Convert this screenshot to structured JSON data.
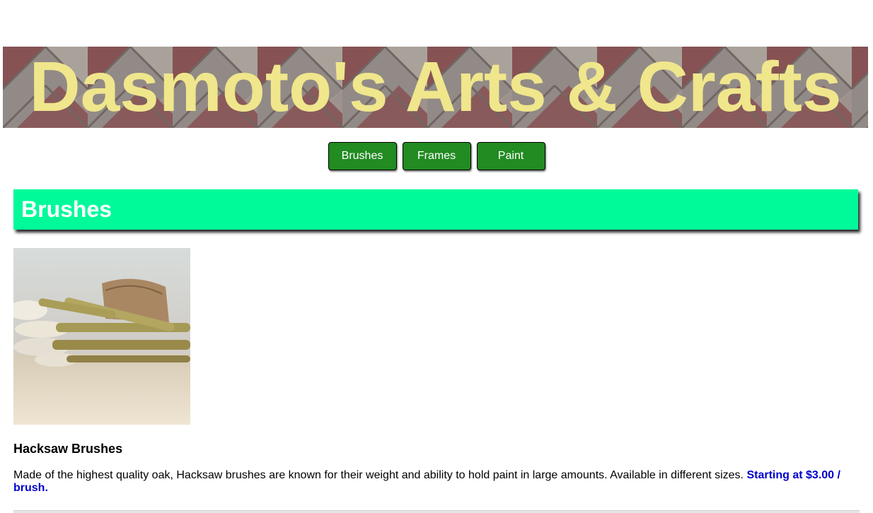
{
  "header": {
    "title": "Dasmoto's Arts & Crafts"
  },
  "nav": {
    "items": [
      {
        "label": "Brushes"
      },
      {
        "label": "Frames"
      },
      {
        "label": "Paint"
      }
    ]
  },
  "section": {
    "title": "Brushes"
  },
  "product": {
    "name": "Hacksaw Brushes",
    "description": "Made of the highest quality oak, Hacksaw brushes are known for their weight and ability to hold paint in large amounts. Available in different sizes.",
    "price": "Starting at $3.00 / brush."
  },
  "colors": {
    "title_text": "#f0e68c",
    "nav_button": "#228b22",
    "section_header": "#00fa9a",
    "price_text": "#0000cd"
  }
}
